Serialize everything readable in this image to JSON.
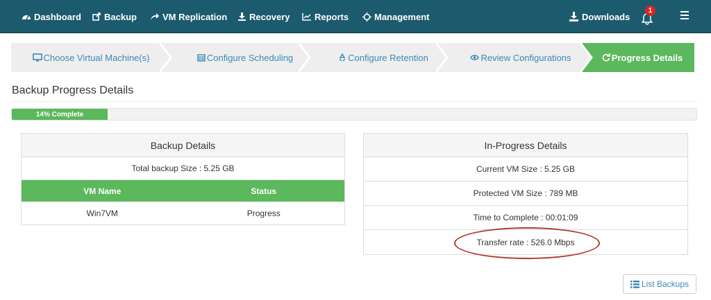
{
  "nav": {
    "items": [
      {
        "label": "Dashboard",
        "icon": "dashboard-icon"
      },
      {
        "label": "Backup",
        "icon": "backup-icon"
      },
      {
        "label": "VM Replication",
        "icon": "share-icon"
      },
      {
        "label": "Recovery",
        "icon": "download-icon"
      },
      {
        "label": "Reports",
        "icon": "line-chart-icon"
      },
      {
        "label": "Management",
        "icon": "crosshair-icon"
      }
    ],
    "downloads_label": "Downloads",
    "notification_count": "1",
    "colors": {
      "bar": "#1c5b6e",
      "badge": "#d9251c"
    }
  },
  "wizard": {
    "steps": [
      {
        "label": "Choose Virtual Machine(s)",
        "icon": "monitor-icon"
      },
      {
        "label": "Configure Scheduling",
        "icon": "calendar-icon"
      },
      {
        "label": "Configure Retention",
        "icon": "recycle-icon"
      },
      {
        "label": "Review Configurations",
        "icon": "eye-icon"
      },
      {
        "label": "Progress Details",
        "icon": "refresh-icon"
      }
    ],
    "active_step": 4,
    "colors": {
      "inactive": "#eeeeee",
      "active": "#5cb85c",
      "link": "#3a8ab5"
    }
  },
  "page": {
    "title": "Backup Progress Details"
  },
  "progress": {
    "percent": 14,
    "label": "14% Complete"
  },
  "backup_details": {
    "heading": "Backup Details",
    "total_size": "Total backup Size : 5.25 GB",
    "columns": [
      "VM Name",
      "Status"
    ],
    "rows": [
      {
        "vm_name": "Win7VM",
        "status": "Progress"
      }
    ]
  },
  "in_progress": {
    "heading": "In-Progress Details",
    "current_vm_size": "Current VM Size : 5.25 GB",
    "protected_vm_size": "Protected VM Size : 789 MB",
    "time_to_complete": "Time to Complete : 00:01:09",
    "transfer_rate": "Transfer rate : 526.0 Mbps"
  },
  "footer": {
    "list_backups_label": "List Backups"
  }
}
